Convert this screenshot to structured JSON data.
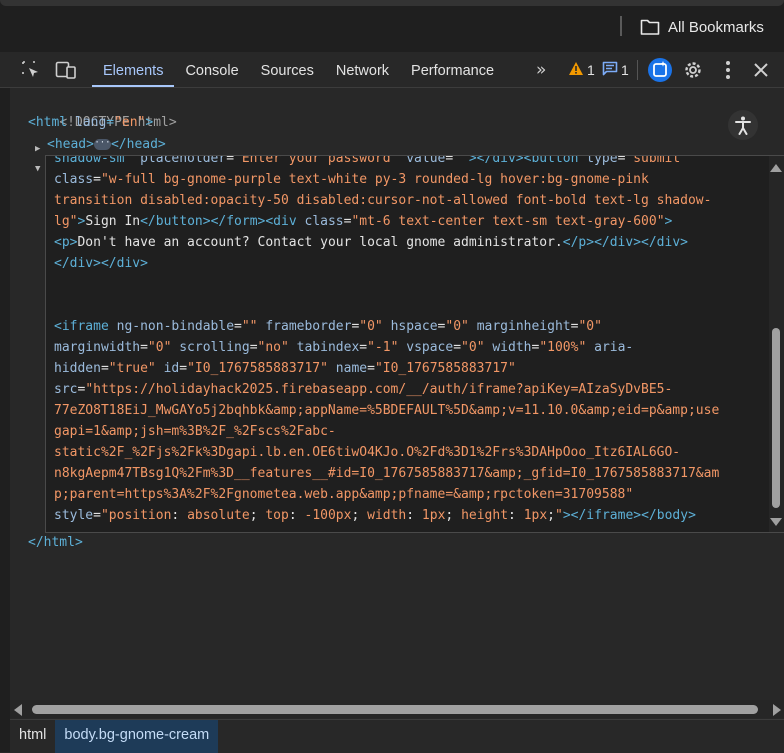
{
  "browser": {
    "bookmarks_label": "All Bookmarks"
  },
  "devtools": {
    "tabs": [
      "Elements",
      "Console",
      "Sources",
      "Network",
      "Performance"
    ],
    "more_tabs": "»",
    "issues_count": "1",
    "messages_count": "1"
  },
  "tree": {
    "doctype": "<!DOCTYPE html>",
    "html_open_tag": "<html ",
    "html_lang_attr": "lang",
    "html_lang_val": "\"en\"",
    "html_open_end": ">",
    "head_open": "<head>",
    "head_close": "</head>",
    "html_close": "</html>"
  },
  "editor_lines": [
    [
      [
        "t",
        "shadow-sm  "
      ],
      [
        "a",
        "placeholder"
      ],
      [
        "x",
        "="
      ],
      [
        "v",
        "\"Enter your password\""
      ],
      [
        "x",
        " "
      ],
      [
        "a",
        "value"
      ],
      [
        "x",
        "="
      ],
      [
        "v",
        "\"\""
      ],
      [
        "t",
        ">"
      ],
      [
        "t",
        "</div>"
      ],
      [
        "t",
        "<button "
      ],
      [
        "a",
        "type"
      ],
      [
        "x",
        "="
      ],
      [
        "v",
        "\"submit\""
      ]
    ],
    [
      [
        "a",
        "class"
      ],
      [
        "x",
        "="
      ],
      [
        "v",
        "\"w-full bg-gnome-purple text-white py-3 rounded-lg hover:bg-gnome-pink"
      ]
    ],
    [
      [
        "v",
        "transition disabled:opacity-50 disabled:cursor-not-allowed font-bold text-lg shadow-"
      ]
    ],
    [
      [
        "v",
        "lg\""
      ],
      [
        "t",
        ">"
      ],
      [
        "x",
        "Sign In"
      ],
      [
        "t",
        "</button>"
      ],
      [
        "t",
        "</form>"
      ],
      [
        "t",
        "<div "
      ],
      [
        "a",
        "class"
      ],
      [
        "x",
        "="
      ],
      [
        "v",
        "\"mt-6 text-center text-sm text-gray-600\""
      ],
      [
        "t",
        ">"
      ]
    ],
    [
      [
        "t",
        "<p>"
      ],
      [
        "x",
        "Don't have an account? Contact your local gnome administrator."
      ],
      [
        "t",
        "</p>"
      ],
      [
        "t",
        "</div>"
      ],
      [
        "t",
        "</div>"
      ]
    ],
    [
      [
        "t",
        "</div>"
      ],
      [
        "t",
        "</div>"
      ]
    ],
    [],
    [],
    [
      [
        "t",
        "<iframe "
      ],
      [
        "a",
        "ng-non-bindable"
      ],
      [
        "x",
        "="
      ],
      [
        "v",
        "\"\""
      ],
      [
        "x",
        " "
      ],
      [
        "a",
        "frameborder"
      ],
      [
        "x",
        "="
      ],
      [
        "v",
        "\"0\""
      ],
      [
        "x",
        " "
      ],
      [
        "a",
        "hspace"
      ],
      [
        "x",
        "="
      ],
      [
        "v",
        "\"0\""
      ],
      [
        "x",
        " "
      ],
      [
        "a",
        "marginheight"
      ],
      [
        "x",
        "="
      ],
      [
        "v",
        "\"0\""
      ]
    ],
    [
      [
        "a",
        "marginwidth"
      ],
      [
        "x",
        "="
      ],
      [
        "v",
        "\"0\""
      ],
      [
        "x",
        " "
      ],
      [
        "a",
        "scrolling"
      ],
      [
        "x",
        "="
      ],
      [
        "v",
        "\"no\""
      ],
      [
        "x",
        " "
      ],
      [
        "a",
        "tabindex"
      ],
      [
        "x",
        "="
      ],
      [
        "v",
        "\"-1\""
      ],
      [
        "x",
        " "
      ],
      [
        "a",
        "vspace"
      ],
      [
        "x",
        "="
      ],
      [
        "v",
        "\"0\""
      ],
      [
        "x",
        " "
      ],
      [
        "a",
        "width"
      ],
      [
        "x",
        "="
      ],
      [
        "v",
        "\"100%\""
      ],
      [
        "x",
        " "
      ],
      [
        "a",
        "aria-"
      ]
    ],
    [
      [
        "a",
        "hidden"
      ],
      [
        "x",
        "="
      ],
      [
        "v",
        "\"true\""
      ],
      [
        "x",
        " "
      ],
      [
        "a",
        "id"
      ],
      [
        "x",
        "="
      ],
      [
        "v",
        "\"I0_1767585883717\""
      ],
      [
        "x",
        " "
      ],
      [
        "a",
        "name"
      ],
      [
        "x",
        "="
      ],
      [
        "v",
        "\"I0_1767585883717\""
      ]
    ],
    [
      [
        "a",
        "src"
      ],
      [
        "x",
        "="
      ],
      [
        "v",
        "\"https://holidayhack2025.firebaseapp.com/__/auth/iframe?apiKey=AIzaSyDvBE5-"
      ]
    ],
    [
      [
        "v",
        "77eZO8T18EiJ_MwGAYo5j2bqhbk&amp;appName=%5BDEFAULT%5D&amp;v=11.10.0&amp;eid=p&amp;use"
      ]
    ],
    [
      [
        "v",
        "gapi=1&amp;jsh=m%3B%2F_%2Fscs%2Fabc-"
      ]
    ],
    [
      [
        "v",
        "static%2F_%2Fjs%2Fk%3Dgapi.lb.en.OE6tiwO4KJo.O%2Fd%3D1%2Frs%3DAHpOoo_Itz6IAL6GO-"
      ]
    ],
    [
      [
        "v",
        "n8kgAepm47TBsg1Q%2Fm%3D__features__#id=I0_1767585883717&amp;_gfid=I0_1767585883717&am"
      ]
    ],
    [
      [
        "v",
        "p;parent=https%3A%2F%2Fgnometea.web.app&amp;pfname=&amp;rpctoken=31709588\""
      ]
    ],
    [
      [
        "a",
        "style"
      ],
      [
        "x",
        "="
      ],
      [
        "v",
        "\"position"
      ],
      [
        "x",
        ": "
      ],
      [
        "v",
        "absolute"
      ],
      [
        "x",
        "; "
      ],
      [
        "v",
        "top"
      ],
      [
        "x",
        ": "
      ],
      [
        "v",
        "-100px"
      ],
      [
        "x",
        "; "
      ],
      [
        "v",
        "width"
      ],
      [
        "x",
        ": "
      ],
      [
        "v",
        "1px"
      ],
      [
        "x",
        "; "
      ],
      [
        "v",
        "height"
      ],
      [
        "x",
        ": "
      ],
      [
        "v",
        "1px"
      ],
      [
        "x",
        ";"
      ],
      [
        "v",
        "\""
      ],
      [
        "t",
        ">"
      ],
      [
        "t",
        "</iframe>"
      ],
      [
        "t",
        "</body>"
      ]
    ]
  ],
  "breadcrumbs": [
    "html",
    "body.bg-gnome-cream"
  ],
  "colors": {
    "tag": "#5db0d7",
    "attribute": "#9bbbdc",
    "value": "#f29766",
    "text": "#e3e3e3",
    "accent": "#a8c7fa",
    "ai_button": "#1a73e8"
  },
  "icons": {
    "inspect": "inspect-element-icon",
    "device": "device-toolbar-icon",
    "warning": "warning-triangle-icon",
    "messages": "message-icon",
    "ai": "ai-assistance-icon",
    "settings": "gear-icon",
    "more": "kebab-menu-icon",
    "close": "close-icon",
    "accessibility": "accessibility-icon",
    "folder": "folder-icon"
  }
}
